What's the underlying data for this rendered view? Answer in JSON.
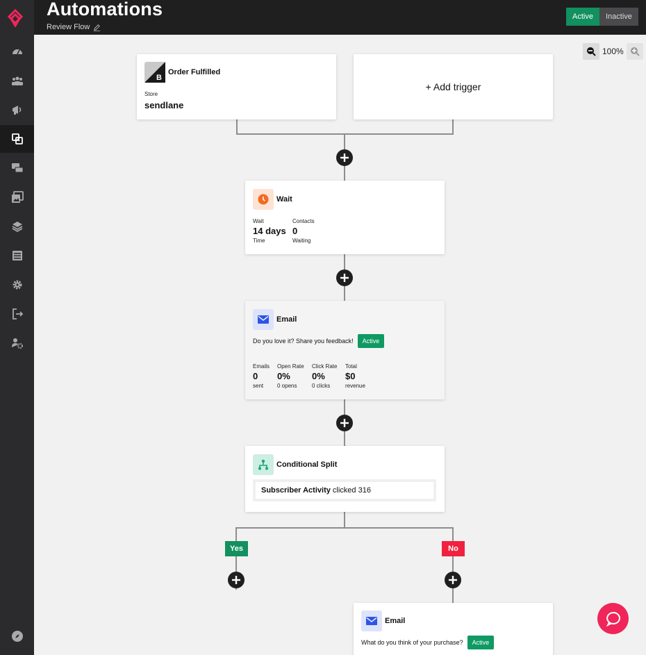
{
  "header": {
    "title": "Automations",
    "subtitle": "Review Flow",
    "status_active": "Active",
    "status_inactive": "Inactive"
  },
  "zoom": {
    "level": "100%"
  },
  "sidebar": {
    "items": [
      "dashboard-icon",
      "contacts-icon",
      "campaigns-icon",
      "automations-icon",
      "conversations-icon",
      "templates-icon",
      "integrations-icon",
      "forms-icon",
      "settings-icon",
      "logout-icon",
      "account-settings-icon"
    ],
    "active": "automations-icon",
    "footer_icon": "compass-icon"
  },
  "flow": {
    "trigger": {
      "title": "Order Fulfilled",
      "store_label": "Store",
      "store_value": "sendlane"
    },
    "add_trigger": "+ Add trigger",
    "wait": {
      "title": "Wait",
      "wait_label": "Wait",
      "wait_value": "14 days",
      "wait_sub": "Time",
      "contacts_label": "Contacts",
      "contacts_value": "0",
      "contacts_sub": "Waiting"
    },
    "email1": {
      "title": "Email",
      "subject": "Do you love it? Share you feedback!",
      "status": "Active",
      "stats": [
        {
          "label": "Emails",
          "value": "0",
          "sub": "sent"
        },
        {
          "label": "Open Rate",
          "value": "0%",
          "sub": "0 opens"
        },
        {
          "label": "Click Rate",
          "value": "0%",
          "sub": "0 clicks"
        },
        {
          "label": "Total",
          "value": "$0",
          "sub": "revenue"
        }
      ]
    },
    "split": {
      "title": "Conditional Split",
      "condition_bold": "Subscriber Activity",
      "condition_rest": "clicked 316"
    },
    "branch_yes": "Yes",
    "branch_no": "No",
    "email2": {
      "title": "Email",
      "subject": "What do you think of your purchase?",
      "status": "Active"
    }
  },
  "colors": {
    "active_green": "#12905f",
    "no_red": "#f0213f",
    "brand_pink": "#f0255a",
    "wait_orange": "#f26b21",
    "email_blue": "#2f55e4",
    "split_teal": "#1aa37a"
  }
}
